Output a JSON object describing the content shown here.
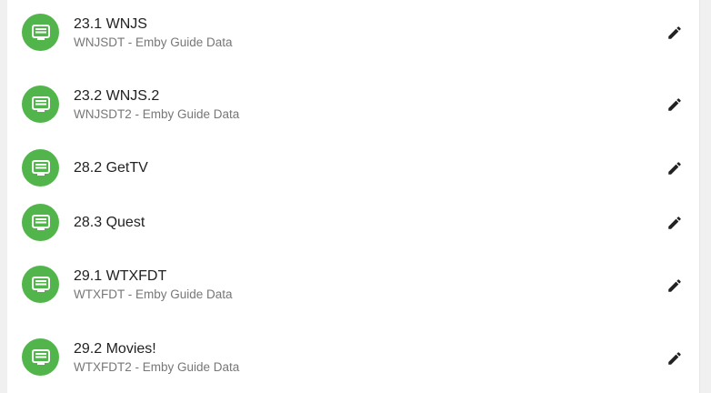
{
  "colors": {
    "accent": "#52b54b",
    "title_text": "#222222",
    "subtitle_text": "#777777",
    "icon": "#222222"
  },
  "channels": [
    {
      "title": "23.1 WNJS",
      "subtitle": "WNJSDT - Emby Guide Data",
      "icon": "tv-guide-icon",
      "action_icon": "edit-pencil-icon"
    },
    {
      "title": "23.2 WNJS.2",
      "subtitle": "WNJSDT2 - Emby Guide Data",
      "icon": "tv-guide-icon",
      "action_icon": "edit-pencil-icon"
    },
    {
      "title": "28.2 GetTV",
      "subtitle": "",
      "icon": "tv-guide-icon",
      "action_icon": "edit-pencil-icon"
    },
    {
      "title": "28.3 Quest",
      "subtitle": "",
      "icon": "tv-guide-icon",
      "action_icon": "edit-pencil-icon"
    },
    {
      "title": "29.1 WTXFDT",
      "subtitle": "WTXFDT - Emby Guide Data",
      "icon": "tv-guide-icon",
      "action_icon": "edit-pencil-icon"
    },
    {
      "title": "29.2 Movies!",
      "subtitle": "WTXFDT2 - Emby Guide Data",
      "icon": "tv-guide-icon",
      "action_icon": "edit-pencil-icon"
    }
  ]
}
